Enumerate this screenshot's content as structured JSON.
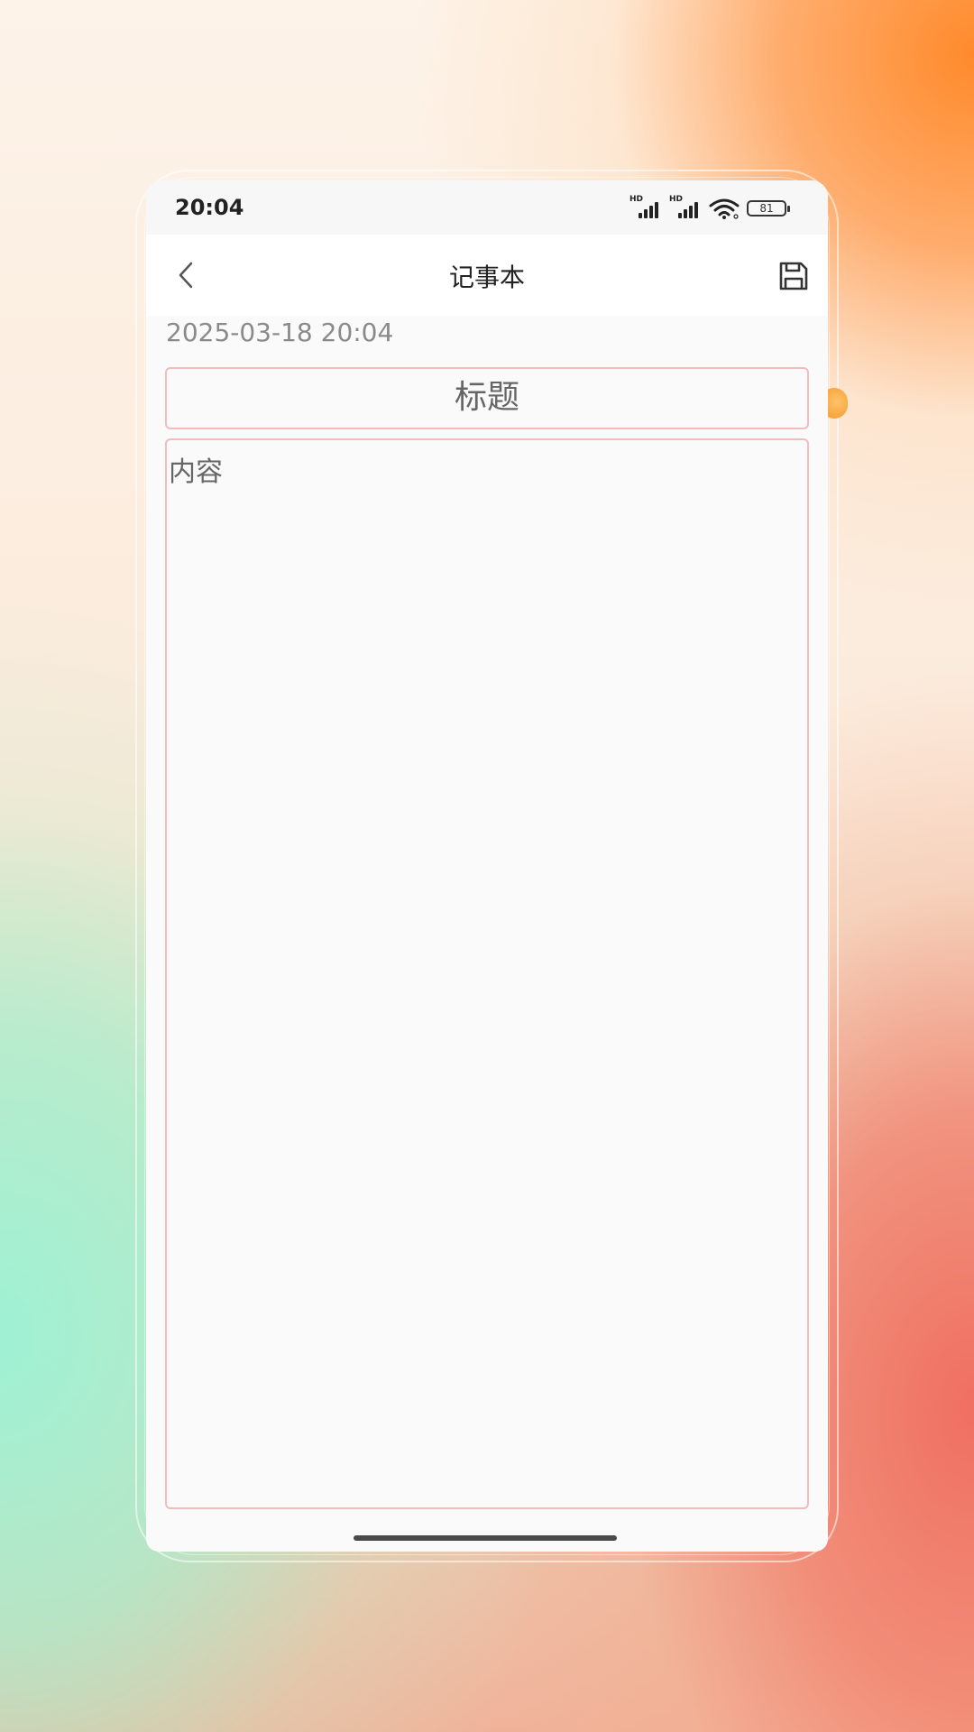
{
  "status_bar": {
    "time": "20:04",
    "signal_1_label": "HD",
    "signal_2_label": "HD",
    "battery_level": "81"
  },
  "nav": {
    "title": "记事本",
    "back_icon": "chevron-left-icon",
    "save_icon": "floppy-disk-icon"
  },
  "note": {
    "date": "2025-03-18 20:04",
    "title_placeholder": "标题",
    "content_placeholder": "内容"
  },
  "colors": {
    "field_border": "#f2bcbc",
    "page_background": "#fafafa",
    "nav_background": "#ffffff",
    "placeholder_text": "#666666",
    "date_text": "#8a8a8a"
  }
}
